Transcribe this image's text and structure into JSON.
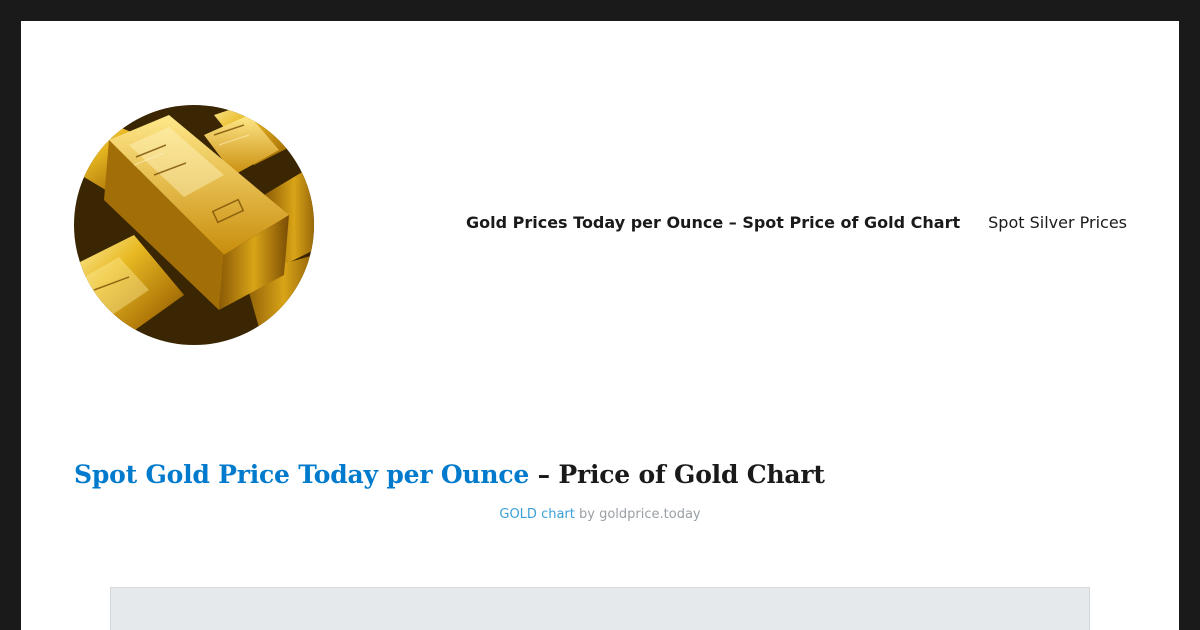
{
  "header": {
    "logo": {
      "icon": "gold-bars-logo"
    },
    "nav": {
      "items": [
        {
          "label": "Gold Prices Today per Ounce – Spot Price of Gold Chart",
          "current": true
        },
        {
          "label": "Spot Silver Prices",
          "current": false
        }
      ]
    }
  },
  "main": {
    "headline": {
      "link_text": "Spot Gold Price Today per Ounce",
      "rest_text": " – Price of Gold Chart"
    },
    "credit": {
      "link_text": "GOLD chart",
      "by_text": " by goldprice.today"
    }
  },
  "colors": {
    "page_border": "#1a1a1a",
    "link_blue": "#007acc",
    "credit_link": "#3b9fd8",
    "credit_text": "#9aa0a6",
    "chart_bg": "#e5e9ec"
  }
}
